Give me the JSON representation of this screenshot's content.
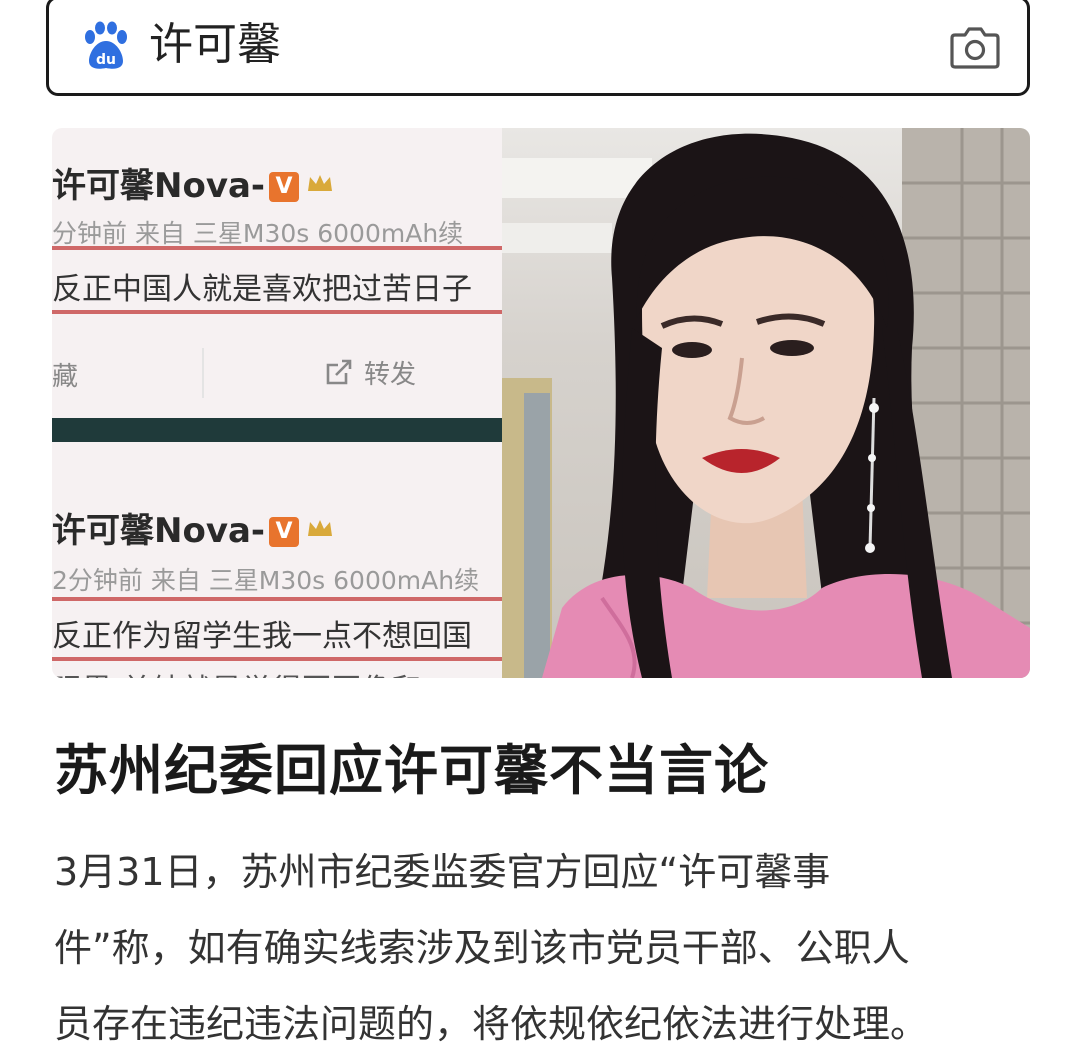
{
  "search": {
    "query": "许可馨",
    "logo_text": "du"
  },
  "image": {
    "weibo_posts": [
      {
        "user": "许可馨Nova-",
        "badge": "V",
        "meta": "分钟前 来自 三星M30s 6000mAh续",
        "text": "反正中国人就是喜欢把过苦日子"
      },
      {
        "user": "许可馨Nova-",
        "badge": "V",
        "meta": "2分钟前 来自 三星M30s 6000mAh续",
        "text": "反正作为留学生我一点不想回国",
        "cut_line": "眼界 单纯就是觉得回国像和"
      }
    ],
    "favorite_label": "藏",
    "repost_label": "转发"
  },
  "article": {
    "headline": "苏州纪委回应许可馨不当言论",
    "summary_lines": [
      "3月31日，苏州市纪委监委官方回应“许可馨事",
      "件”称，如有确实线索涉及到该市党员干部、公职人",
      "员存在违纪违法问题的，将依规依纪依法进行处理。"
    ]
  },
  "colors": {
    "baidu_blue": "#2f6fe0",
    "weibo_red": "#c23a3a",
    "badge_orange": "#e8742d",
    "dress_pink": "#e58bb4"
  }
}
